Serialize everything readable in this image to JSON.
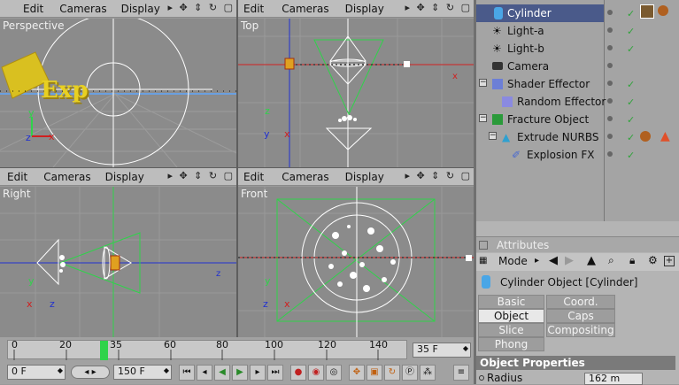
{
  "viewport_menu": {
    "edit": "Edit",
    "cameras": "Cameras",
    "display": "Display",
    "arrow": "▸"
  },
  "viewports": {
    "perspective": {
      "label": "Perspective"
    },
    "top": {
      "label": "Top"
    },
    "right": {
      "label": "Right"
    },
    "front": {
      "label": "Front"
    }
  },
  "axes": {
    "x": "x",
    "y": "y",
    "z": "z"
  },
  "text3d": "Exp",
  "objects": [
    {
      "name": "Cylinder",
      "icon": "cylinder-icon",
      "selected": true
    },
    {
      "name": "Light-a",
      "icon": "light-icon"
    },
    {
      "name": "Light-b",
      "icon": "light-icon"
    },
    {
      "name": "Camera",
      "icon": "camera-icon"
    },
    {
      "name": "Shader Effector",
      "icon": "shader-effector-icon"
    },
    {
      "name": "Random Effector",
      "icon": "random-effector-icon"
    },
    {
      "name": "Fracture Object",
      "icon": "fracture-icon"
    },
    {
      "name": "Extrude NURBS",
      "icon": "extrude-nurbs-icon"
    },
    {
      "name": "Explosion FX",
      "icon": "explosion-icon"
    }
  ],
  "attributes": {
    "title": "Attributes",
    "mode": "Mode",
    "object_title": "Cylinder Object [Cylinder]",
    "tabs": [
      "Basic",
      "Coord.",
      "Object",
      "Caps",
      "Slice",
      "Compositing",
      "Phong"
    ],
    "active_tab": "Object",
    "section": "Object Properties",
    "radius_label": "Radius",
    "radius_value": "162 m"
  },
  "timeline": {
    "ticks": [
      "0",
      "20",
      "35",
      "60",
      "80",
      "100",
      "120",
      "140"
    ],
    "current_frame": "35 F",
    "start_frame": "0 F",
    "end_frame": "150 F"
  },
  "colors": {
    "accent_green": "#2fd34a",
    "grid_red": "#d02020",
    "grid_blue": "#2030d0",
    "selected_blue": "#4a5a8a"
  }
}
